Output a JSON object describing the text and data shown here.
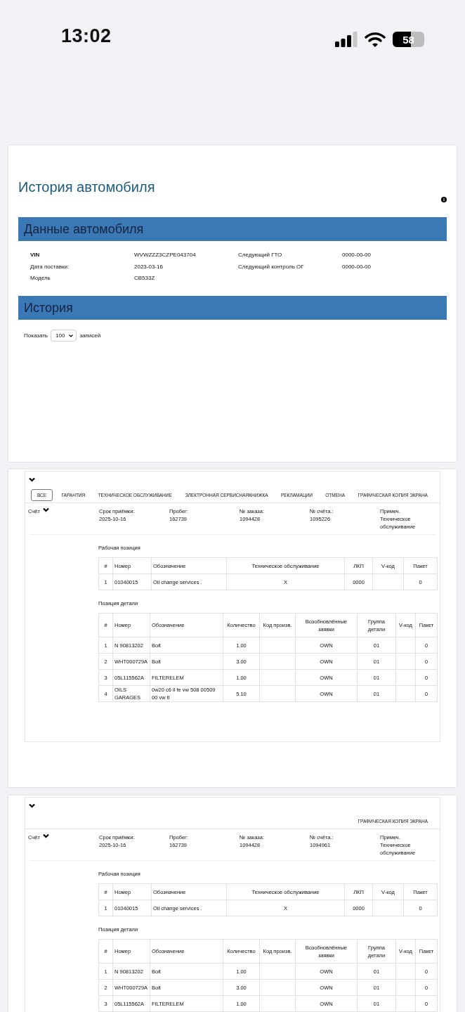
{
  "status_bar": {
    "time": "13:02",
    "battery": "58"
  },
  "title": "История автомобиля",
  "vehicle": {
    "heading": "Данные автомобиля",
    "fields": [
      {
        "label": "VIN",
        "value": "WVWZZZ3CZPE043704",
        "emphasis": true
      },
      {
        "label": "Следующий ГТО",
        "value": "0000-00-00",
        "emphasis": false
      },
      {
        "label": "Дата поставки:",
        "value": "2023-03-16",
        "emphasis": false
      },
      {
        "label": "Следующий контроль ОГ",
        "value": "0000-00-00",
        "emphasis": false
      },
      {
        "label": "Модель",
        "value": "CB533Z",
        "emphasis": false
      }
    ]
  },
  "history": {
    "heading": "История",
    "length_menu": {
      "before": "Показать",
      "value": "100",
      "after": "записей"
    }
  },
  "records": [
    {
      "tabs": [
        {
          "label": "ВСЕ",
          "selected": true
        },
        {
          "label": "ГАРАНТИЯ",
          "selected": false
        },
        {
          "label": "ТЕХНИЧЕСКОЕ ОБСЛУЖИВАНИЕ",
          "selected": false
        },
        {
          "label": "ЭЛЕКТРОННАЯ СЕРВИСНАЯКНИЖКА",
          "selected": false
        },
        {
          "label": "РЕКЛАМАЦИИ",
          "selected": false
        },
        {
          "label": "ОТМЕНА",
          "selected": false
        },
        {
          "label": "ГРАФИЧЕСКАЯ КОПИЯ ЭКРАНА",
          "selected": false
        }
      ],
      "invoice_label": "Счёт",
      "meta": [
        {
          "label": "Срок приёмки:",
          "value": "2025-10-16"
        },
        {
          "label": "Пробег:",
          "value": "162739"
        },
        {
          "label": "№ заказа:",
          "value": "1094428"
        },
        {
          "label": "№ счёта.:",
          "value": "1095226"
        },
        {
          "label": "Примеч.",
          "value": "Техническое обслуживание"
        }
      ],
      "work": {
        "title": "Рабочая позиция",
        "kind": "work",
        "columns": [
          "#",
          "Номер",
          "Обозначение",
          "Техническое обслуживание",
          "ЛКП",
          "V-код",
          "Пакет"
        ],
        "rows": [
          [
            "1",
            "01040015",
            "Oil change services .",
            "X",
            "0000",
            "",
            "0"
          ]
        ]
      },
      "parts": {
        "title": "Позиция детали",
        "kind": "parts",
        "columns": [
          "#",
          "Номер",
          "Обозначение",
          "Количество",
          "Код произв.",
          "Возобновлённые заявки",
          "Группа детали",
          "V-код",
          "Пакет"
        ],
        "rows": [
          [
            "1",
            "N 90813202",
            "Bolt",
            "1.00",
            "",
            "OWN",
            "01",
            "",
            "0"
          ],
          [
            "2",
            "WHT000729A",
            "Bolt",
            "3.00",
            "",
            "OWN",
            "01",
            "",
            "0"
          ],
          [
            "3",
            "05L115562A",
            "FILTERELEM",
            "1.00",
            "",
            "OWN",
            "01",
            "",
            "0"
          ],
          [
            "4",
            "OILS GARAGES",
            "0w20 c6 ll fe vw 508 00509 00 vw tl",
            "5.10",
            "",
            "OWN",
            "01",
            "",
            "0"
          ]
        ]
      }
    },
    {
      "tabs": [
        {
          "label": "ГРАФИЧЕСКАЯ КОПИЯ ЭКРАНА",
          "selected": false
        }
      ],
      "invoice_label": "Счёт",
      "meta": [
        {
          "label": "Срок приёмки:",
          "value": "2025-10-16"
        },
        {
          "label": "Пробег:",
          "value": "162739"
        },
        {
          "label": "№ заказа:",
          "value": "1094428"
        },
        {
          "label": "№ счёта.:",
          "value": "1094961"
        },
        {
          "label": "Примеч.",
          "value": "Техническое обслуживание"
        }
      ],
      "work": {
        "title": "Рабочая позиция",
        "kind": "work",
        "columns": [
          "#",
          "Номер",
          "Обозначение",
          "Техническое обслуживание",
          "ЛКП",
          "V-код",
          "Пакет"
        ],
        "rows": [
          [
            "1",
            "01040015",
            "Oil change services .",
            "X",
            "0000",
            "",
            "0"
          ]
        ]
      },
      "parts": {
        "title": "Позиция детали",
        "kind": "parts",
        "columns": [
          "#",
          "Номер",
          "Обозначение",
          "Количество",
          "Код произв.",
          "Возобновлённые заявки",
          "Группа детали",
          "V-код",
          "Пакет"
        ],
        "rows": [
          [
            "1",
            "N 90813202",
            "Bolt",
            "1.00",
            "",
            "OWN",
            "01",
            "",
            "0"
          ],
          [
            "2",
            "WHT000729A",
            "Bolt",
            "3.00",
            "",
            "OWN",
            "01",
            "",
            "0"
          ],
          [
            "3",
            "05L115562A",
            "FILTERELEM",
            "1.00",
            "",
            "OWN",
            "01",
            "",
            "0"
          ]
        ]
      }
    }
  ]
}
